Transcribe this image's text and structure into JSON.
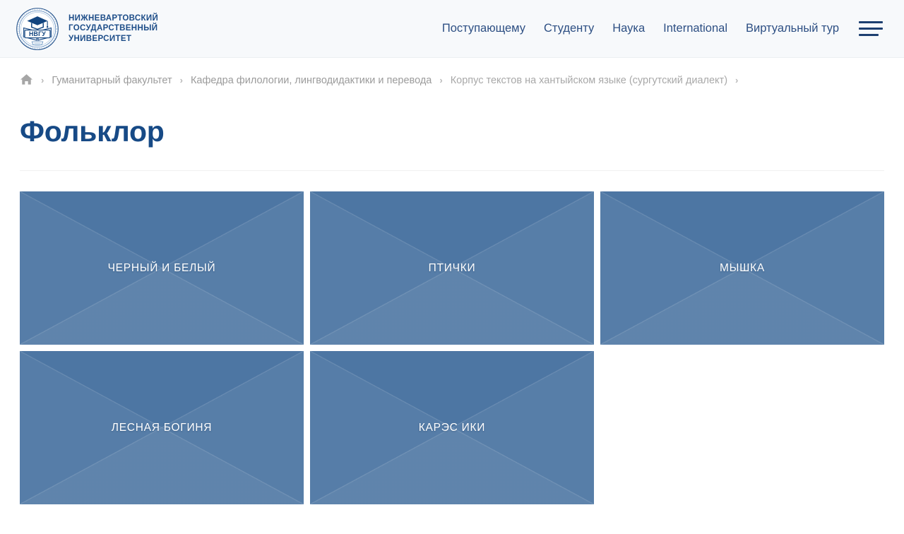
{
  "header": {
    "logo": {
      "icon": "nvgu-emblem-logo",
      "abbr": "НВГУ",
      "name": "НИЖНЕВАРТОВСКИЙ\nГОСУДАРСТВЕННЫЙ\nУНИВЕРСИТЕТ"
    },
    "nav": [
      {
        "label": "Поступающему"
      },
      {
        "label": "Студенту"
      },
      {
        "label": "Наука"
      },
      {
        "label": "International"
      },
      {
        "label": "Виртуальный тур"
      }
    ],
    "menu_button": {
      "icon": "hamburger-menu-icon"
    }
  },
  "breadcrumb": {
    "home": {
      "icon": "home-icon"
    },
    "separator": "›",
    "items": [
      {
        "label": "Гуманитарный факультет"
      },
      {
        "label": "Кафедра филологии, лингводидактики и перевода"
      },
      {
        "label": "Корпус текстов на хантыйском языке (сургутский диалект)"
      }
    ]
  },
  "main": {
    "title": "Фольклор",
    "tiles": [
      {
        "label": "ЧЕРНЫЙ И БЕЛЫЙ"
      },
      {
        "label": "ПТИЧКИ"
      },
      {
        "label": "МЫШКА"
      },
      {
        "label": "ЛЕСНАЯ БОГИНЯ"
      },
      {
        "label": "КАРЭС ИКИ"
      }
    ]
  },
  "colors": {
    "brand_blue": "#1d4d88",
    "title_blue": "#174a86",
    "nav_blue": "#2d4f83",
    "tile_blue": "#4d76a3",
    "tile_facet": "#5a7da8",
    "header_bg": "#f7f9fb",
    "breadcrumb_gray": "#9b9b9b"
  }
}
